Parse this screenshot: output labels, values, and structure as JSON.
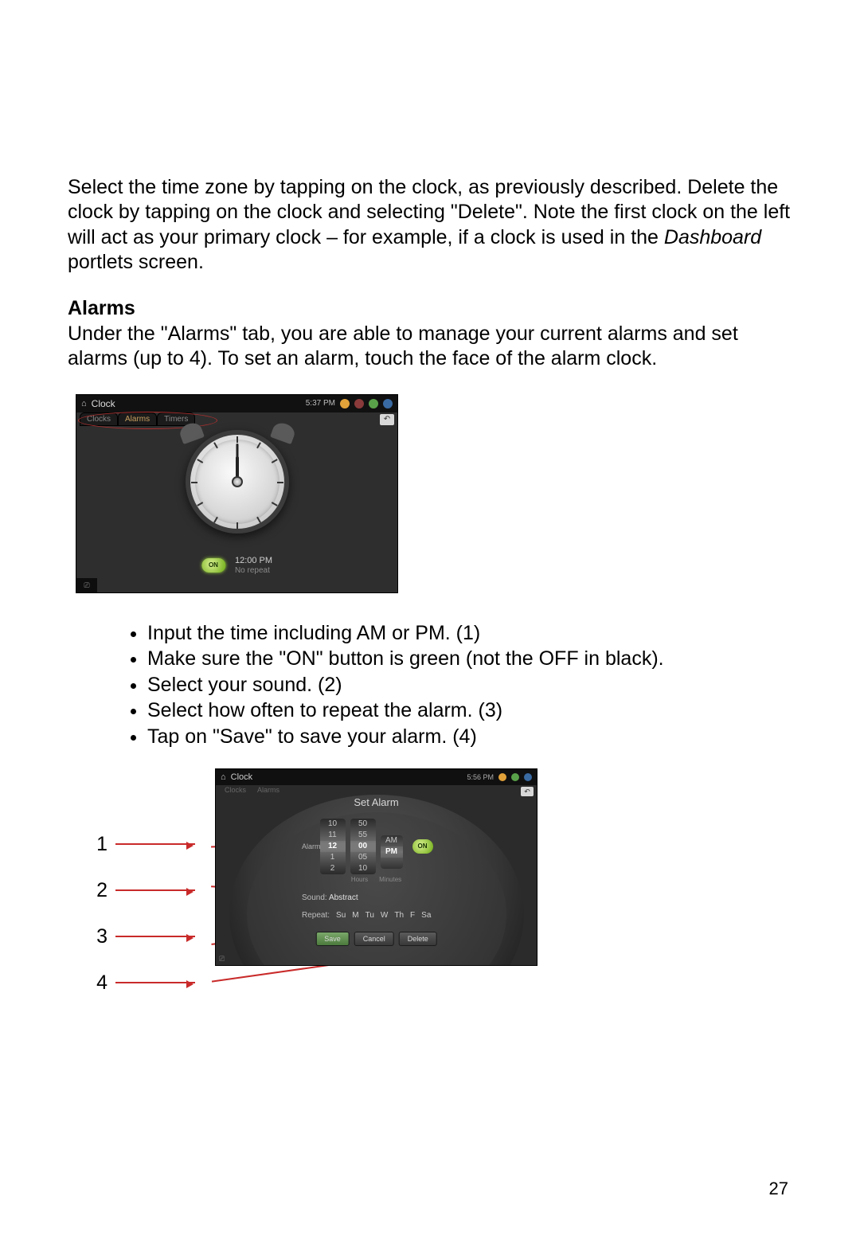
{
  "para1_a": "Select the time zone by tapping on the clock, as previously described. Delete the clock by tapping on the clock and selecting \"Delete\".    Note the first clock on the left will act as your primary clock – for example, if a clock is used in the ",
  "para1_italic": "Dashboard",
  "para1_b": " portlets screen.",
  "heading": "Alarms",
  "para2": "Under the \"Alarms\" tab, you are able to manage your current alarms and set alarms (up to 4).    To set an alarm, touch the face of the alarm clock.",
  "bullets": [
    "Input the time including AM or PM. (1)",
    "Make sure the \"ON\" button is green (not the OFF in black).",
    "Select your sound. (2)",
    "Select how often to repeat the alarm. (3)",
    "Tap on \"Save\" to save your alarm. (4)"
  ],
  "callouts": [
    "1",
    "2",
    "3",
    "4"
  ],
  "page_number": "27",
  "shot1": {
    "app_title": "Clock",
    "statusbar_time": "5:37 PM",
    "tabs": [
      "Clocks",
      "Alarms",
      "Timers"
    ],
    "on_label": "ON",
    "alarm_time": "12:00 PM",
    "alarm_repeat": "No repeat",
    "back_glyph": "↶"
  },
  "shot2": {
    "app_title": "Clock",
    "statusbar_time": "5:56 PM",
    "tabs": [
      "Clocks",
      "Alarms"
    ],
    "dialog_title": "Set Alarm",
    "alarm_time_label": "Alarm time:",
    "hours": [
      "10",
      "11",
      "12",
      "1",
      "2"
    ],
    "minutes": [
      "50",
      "55",
      "00",
      "05",
      "10"
    ],
    "ampm": [
      "AM",
      "PM"
    ],
    "wheel_label_hours": "Hours",
    "wheel_label_minutes": "Minutes",
    "on_label": "ON",
    "sound_label": "Sound:",
    "sound_value": "Abstract",
    "repeat_label": "Repeat:",
    "days": [
      "Su",
      "M",
      "Tu",
      "W",
      "Th",
      "F",
      "Sa"
    ],
    "buttons": {
      "save": "Save",
      "cancel": "Cancel",
      "delete": "Delete"
    },
    "back_glyph": "↶"
  }
}
